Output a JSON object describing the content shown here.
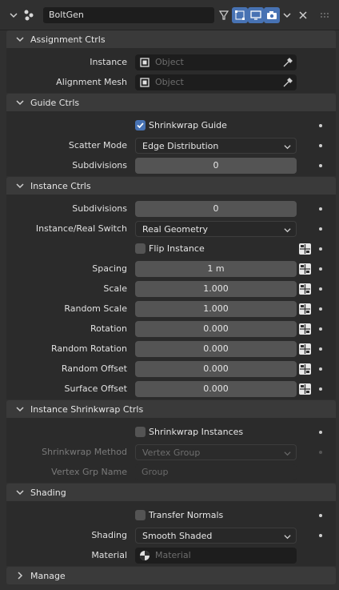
{
  "header": {
    "name": "BoltGen"
  },
  "sections": {
    "assignment": {
      "title": "Assignment Ctrls"
    },
    "guide": {
      "title": "Guide Ctrls"
    },
    "instance": {
      "title": "Instance Ctrls"
    },
    "shrink": {
      "title": "Instance Shrinkwrap Ctrls"
    },
    "shading": {
      "title": "Shading"
    },
    "manage": {
      "title": "Manage"
    }
  },
  "assignment": {
    "instance_label": "Instance",
    "instance_placeholder": "Object",
    "mesh_label": "Alignment Mesh",
    "mesh_placeholder": "Object"
  },
  "guide": {
    "shrinkwrap_label": "Shrinkwrap Guide",
    "scatter_label": "Scatter Mode",
    "scatter_value": "Edge Distribution",
    "subdiv_label": "Subdivisions",
    "subdiv_value": "0"
  },
  "instance": {
    "subdiv_label": "Subdivisions",
    "subdiv_value": "0",
    "switch_label": "Instance/Real Switch",
    "switch_value": "Real Geometry",
    "flip_label": "Flip Instance",
    "spacing_label": "Spacing",
    "spacing_value": "1 m",
    "scale_label": "Scale",
    "scale_value": "1.000",
    "rscale_label": "Random Scale",
    "rscale_value": "1.000",
    "rotation_label": "Rotation",
    "rotation_value": "0.000",
    "rrotation_label": "Random Rotation",
    "rrotation_value": "0.000",
    "roffset_label": "Random Offset",
    "roffset_value": "0.000",
    "soffset_label": "Surface Offset",
    "soffset_value": "0.000"
  },
  "shrink": {
    "instances_label": "Shrinkwrap Instances",
    "method_label": "Shrinkwrap Method",
    "method_value": "Vertex Group",
    "vgroup_label": "Vertex Grp Name",
    "vgroup_placeholder": "Group"
  },
  "shading": {
    "transfer_label": "Transfer Normals",
    "shading_label": "Shading",
    "shading_value": "Smooth Shaded",
    "material_label": "Material",
    "material_placeholder": "Material"
  },
  "colors": {
    "accent": "#4772b3",
    "panel": "#303030",
    "field": "#545454"
  }
}
